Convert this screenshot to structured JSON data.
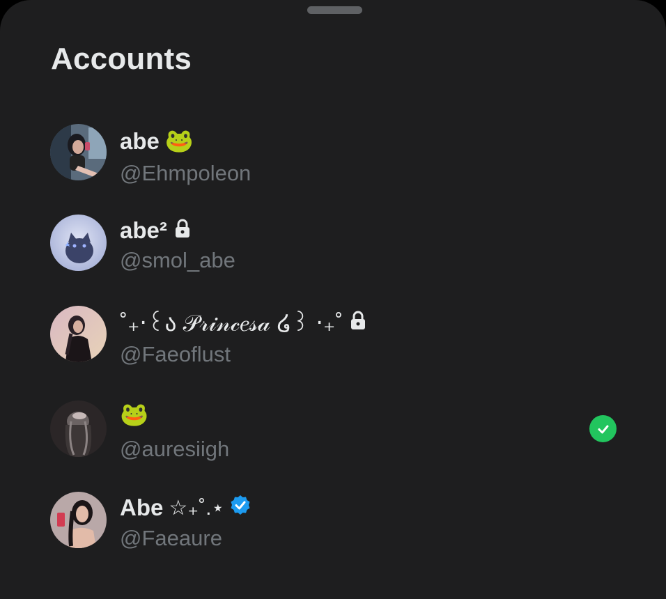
{
  "sheet": {
    "title": "Accounts"
  },
  "accounts": [
    {
      "name": "abe",
      "decoration": "🐸",
      "handle": "@Ehmpoleon",
      "locked": false,
      "verified": false,
      "active": false
    },
    {
      "name": "abe²",
      "decoration": "",
      "handle": "@smol_abe",
      "locked": true,
      "verified": false,
      "active": false
    },
    {
      "name": "˚₊‧꒰ა 𝒫𝓇𝒾𝓃𝒸𝑒𝓈𝒶 ໒꒱ ‧₊˚",
      "decoration": "",
      "handle": "@Faeoflust",
      "locked": true,
      "verified": false,
      "active": false
    },
    {
      "name": "",
      "decoration": "🐸",
      "handle": "@auresiigh",
      "locked": false,
      "verified": false,
      "active": true
    },
    {
      "name": "Abe",
      "decoration": "☆₊˚.⋆",
      "handle": "@Faeaure",
      "locked": false,
      "verified": true,
      "active": false
    }
  ],
  "colors": {
    "background": "#1e1e1f",
    "text": "#e7e9ea",
    "secondary": "#71767b",
    "active": "#22c55e",
    "verified": "#1d9bf0"
  },
  "icons": {
    "lock": "lock-icon",
    "active": "check-circle-icon",
    "verified": "verified-badge-icon"
  }
}
